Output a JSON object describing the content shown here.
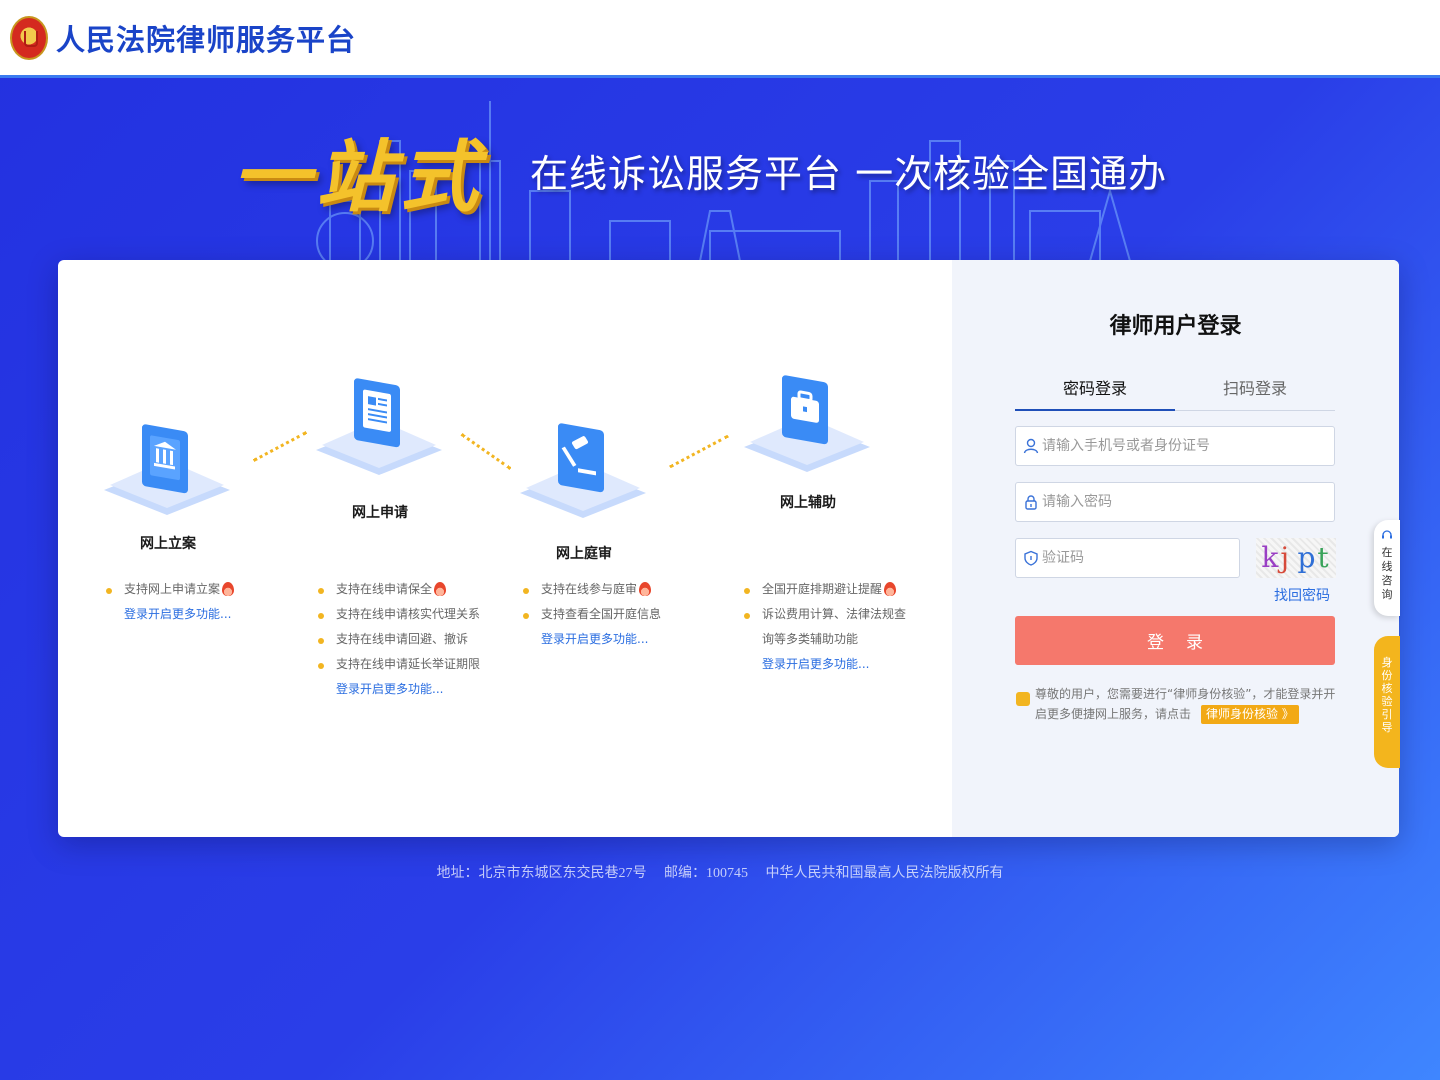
{
  "header": {
    "site_title": "人民法院律师服务平台"
  },
  "banner": {
    "slogan_big": "一站式",
    "slogan_small": "在线诉讼服务平台 一次核验全国通办"
  },
  "features": [
    {
      "title": "网上立案",
      "bullets": [
        {
          "text": "支持网上申请立案",
          "hot": true
        }
      ],
      "more": "登录开启更多功能..."
    },
    {
      "title": "网上申请",
      "bullets": [
        {
          "text": "支持在线申请保全",
          "hot": true
        },
        {
          "text": "支持在线申请核实代理关系",
          "hot": false
        },
        {
          "text": "支持在线申请回避、撤诉",
          "hot": false
        },
        {
          "text": "支持在线申请延长举证期限",
          "hot": false
        }
      ],
      "more": "登录开启更多功能..."
    },
    {
      "title": "网上庭审",
      "bullets": [
        {
          "text": "支持在线参与庭审",
          "hot": true
        },
        {
          "text": "支持查看全国开庭信息",
          "hot": false
        }
      ],
      "more": "登录开启更多功能..."
    },
    {
      "title": "网上辅助",
      "bullets": [
        {
          "text": "全国开庭排期避让提醒",
          "hot": true
        },
        {
          "text": "诉讼费用计算、法律法规查",
          "hot": false
        },
        {
          "text": "询等多类辅助功能",
          "hot": false,
          "nodot": true
        }
      ],
      "more": "登录开启更多功能..."
    }
  ],
  "login": {
    "title": "律师用户登录",
    "tab_password": "密码登录",
    "tab_qr": "扫码登录",
    "username_placeholder": "请输入手机号或者身份证号",
    "password_placeholder": "请输入密码",
    "captcha_placeholder": "验证码",
    "captcha_text": "kjpt",
    "forgot": "找回密码",
    "submit": "登录",
    "notice": "尊敬的用户，您需要进行“律师身份核验”，才能登录并开启更多便捷网上服务，请点击",
    "verify_button": "律师身份核验 》"
  },
  "side": {
    "consult": "在线咨询",
    "guide": "身份核验引导"
  },
  "footer": {
    "address": "地址：北京市东城区东交民巷27号",
    "postcode": "邮编：100745",
    "copyright": "中华人民共和国最高人民法院版权所有"
  },
  "colors": {
    "brand_blue": "#1a44c8",
    "accent_yellow": "#f2b521",
    "login_button": "#f5786c",
    "link_blue": "#2a6de0"
  }
}
